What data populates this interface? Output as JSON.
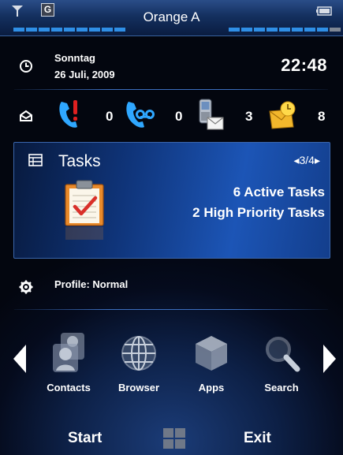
{
  "status_bar": {
    "carrier": "Orange A",
    "network_badge": "G",
    "signal_icon": "antenna-icon",
    "battery_icon": "battery-icon"
  },
  "date_row": {
    "icon": "clock-icon",
    "weekday": "Sonntag",
    "date": "26 Juli, 2009",
    "time": "22:48"
  },
  "notifications": {
    "icon": "inbox-icon",
    "items": [
      {
        "icon": "missed-call-icon",
        "count": "0"
      },
      {
        "icon": "voicemail-icon",
        "count": "0"
      },
      {
        "icon": "sms-icon",
        "count": "3"
      },
      {
        "icon": "email-icon",
        "count": "8"
      }
    ]
  },
  "tasks": {
    "icon": "tasks-icon",
    "title": "Tasks",
    "pager": "◂3/4▸",
    "active": "6 Active Tasks",
    "high_priority": "2 High Priority Tasks"
  },
  "profile": {
    "icon": "gear-icon",
    "label": "Profile: Normal"
  },
  "apps": [
    {
      "label": "Contacts",
      "icon": "contacts-icon"
    },
    {
      "label": "Browser",
      "icon": "globe-icon"
    },
    {
      "label": "Apps",
      "icon": "cube-icon"
    },
    {
      "label": "Search",
      "icon": "magnifier-icon"
    }
  ],
  "softkeys": {
    "left": "Start",
    "right": "Exit"
  },
  "colors": {
    "accent": "#2f8fe6",
    "panel": "#1c55b6",
    "background": "#050b1d"
  }
}
